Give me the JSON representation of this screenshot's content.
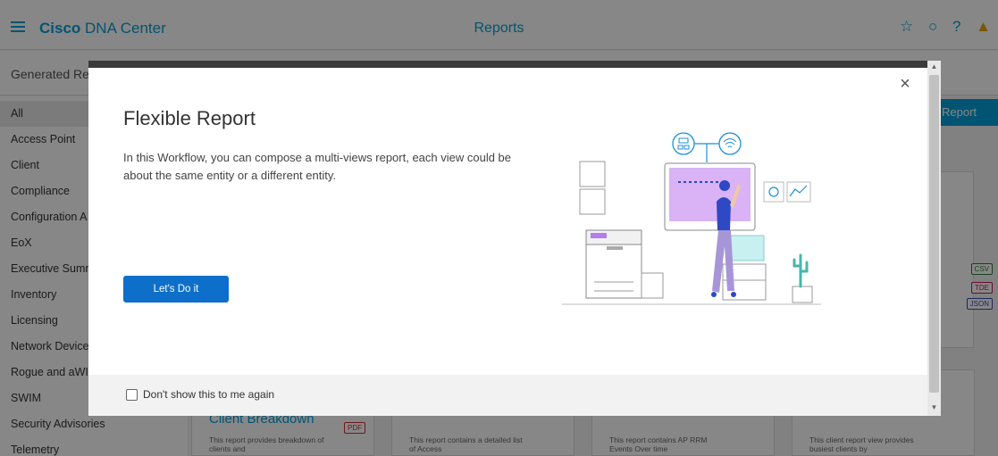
{
  "app": {
    "brand_bold": "Cisco",
    "brand_rest": "DNA Center",
    "title": "Reports"
  },
  "topbar_icons": [
    "star-icon",
    "search-icon",
    "help-icon",
    "notification-icon"
  ],
  "subheader": {
    "title": "Generated Re"
  },
  "sidebar": {
    "items": [
      {
        "label": "All",
        "active": true
      },
      {
        "label": "Access Point"
      },
      {
        "label": "Client"
      },
      {
        "label": "Compliance"
      },
      {
        "label": "Configuration A"
      },
      {
        "label": "EoX"
      },
      {
        "label": "Executive Sumr"
      },
      {
        "label": "Inventory"
      },
      {
        "label": "Licensing"
      },
      {
        "label": "Network Device"
      },
      {
        "label": "Rogue and aWI"
      },
      {
        "label": "SWIM"
      },
      {
        "label": "Security Advisories"
      },
      {
        "label": "Telemetry"
      }
    ]
  },
  "create_button": {
    "label": "Report"
  },
  "badges": {
    "csv": "CSV",
    "tde": "TDE",
    "json": "JSON"
  },
  "cards": [
    {
      "title": "Client Breakdown",
      "desc": "This report provides breakdown of clients and",
      "badge": "PDF"
    },
    {
      "title": "",
      "desc": "This report contains a detailed list of Access"
    },
    {
      "title": "",
      "desc": "This report contains AP RRM Events Over time"
    },
    {
      "title": "",
      "desc": "This client report view provides busiest clients by"
    }
  ],
  "modal": {
    "title": "Flexible Report",
    "description": "In this Workflow, you can compose a multi-views report, each view could be about the same entity or a different entity.",
    "primary_button": "Let's Do it",
    "footer_checkbox_label": "Don't show this to me again",
    "close_glyph": "×"
  },
  "colors": {
    "brand": "#049fd9",
    "primary_button": "#0d6fc9",
    "illustration_screen": "#d9b3f5",
    "illustration_person": "#2f48c4"
  }
}
